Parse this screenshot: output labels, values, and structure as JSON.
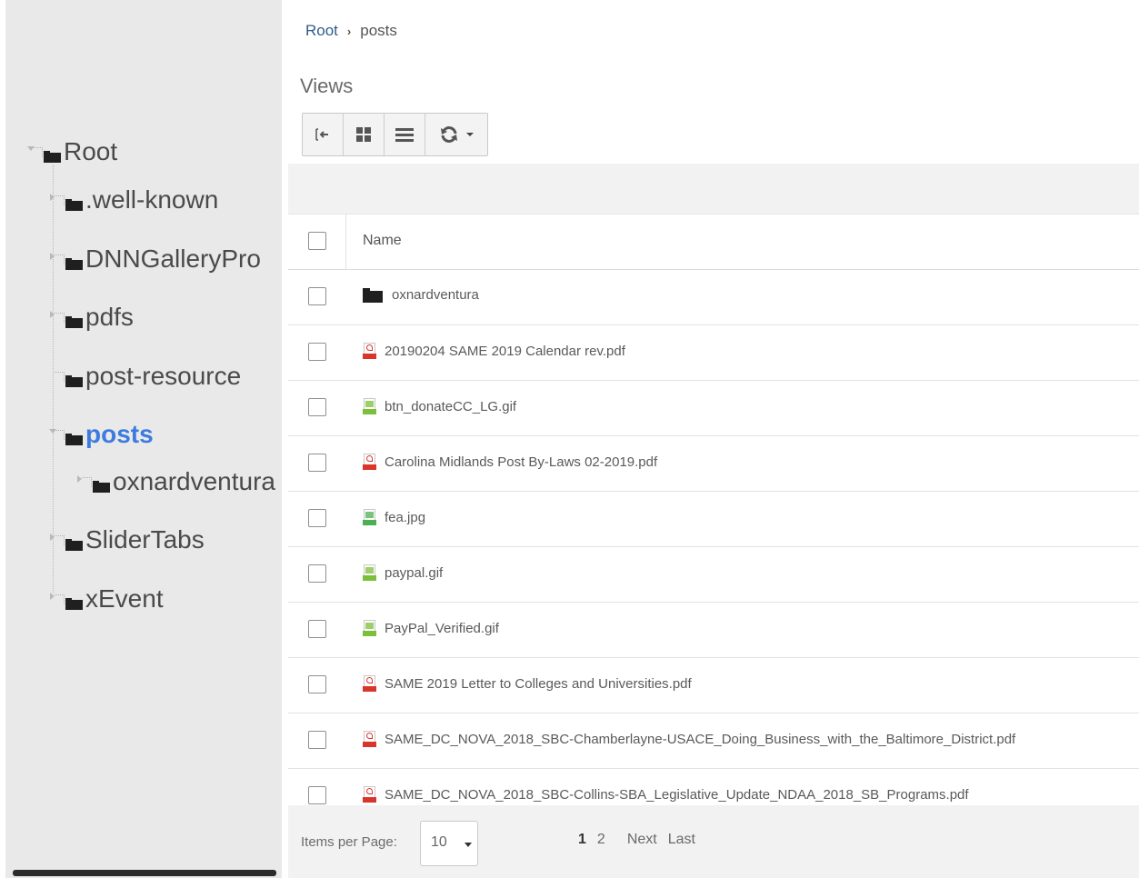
{
  "breadcrumb": {
    "root": "Root",
    "separator": "›",
    "current": "posts"
  },
  "views": {
    "label": "Views",
    "toolbar": [
      {
        "name": "collapse-panel-icon"
      },
      {
        "name": "thumbnail-view-icon"
      },
      {
        "name": "list-view-icon"
      },
      {
        "name": "refresh-icon"
      }
    ]
  },
  "tree": {
    "nodes": [
      {
        "label": "Root",
        "state": "expanded",
        "selected": false
      },
      {
        "label": ".well-known",
        "state": "collapsed",
        "selected": false
      },
      {
        "label": "DNNGalleryPro",
        "state": "collapsed",
        "selected": false
      },
      {
        "label": "pdfs",
        "state": "collapsed",
        "selected": false
      },
      {
        "label": "post-resource",
        "state": "leaf",
        "selected": false
      },
      {
        "label": "posts",
        "state": "expanded",
        "selected": true
      },
      {
        "label": "oxnardventura",
        "state": "collapsed",
        "selected": false
      },
      {
        "label": "SliderTabs",
        "state": "collapsed",
        "selected": false
      },
      {
        "label": "xEvent",
        "state": "collapsed",
        "selected": false
      }
    ]
  },
  "grid": {
    "header": {
      "name": "Name"
    },
    "rows": [
      {
        "name": "oxnardventura",
        "type": "folder"
      },
      {
        "name": "20190204 SAME 2019 Calendar rev.pdf",
        "type": "pdf"
      },
      {
        "name": "btn_donateCC_LG.gif",
        "type": "gif"
      },
      {
        "name": "Carolina Midlands Post By-Laws 02-2019.pdf",
        "type": "pdf"
      },
      {
        "name": "fea.jpg",
        "type": "jpg"
      },
      {
        "name": "paypal.gif",
        "type": "gif"
      },
      {
        "name": "PayPal_Verified.gif",
        "type": "gif"
      },
      {
        "name": "SAME 2019 Letter to Colleges and Universities.pdf",
        "type": "pdf"
      },
      {
        "name": "SAME_DC_NOVA_2018_SBC-Chamberlayne-USACE_Doing_Business_with_the_Baltimore_District.pdf",
        "type": "pdf"
      },
      {
        "name": "SAME_DC_NOVA_2018_SBC-Collins-SBA_Legislative_Update_NDAA_2018_SB_Programs.pdf",
        "type": "pdf"
      }
    ]
  },
  "footer": {
    "items_per_page_label": "Items per Page:",
    "items_per_page_value": "10",
    "pages": [
      "1",
      "2"
    ],
    "current_page": "1",
    "next_label": "Next",
    "last_label": "Last"
  },
  "colors": {
    "selected_tree": "#3d7be0",
    "pdf": "#d9352b",
    "gif": "#7cbf3a",
    "jpg": "#4caf50"
  }
}
